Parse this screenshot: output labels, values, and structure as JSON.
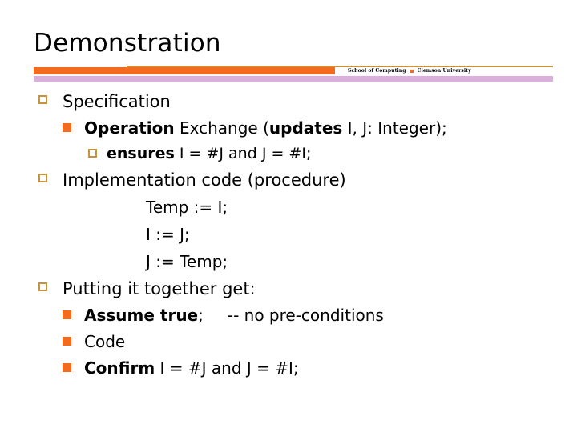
{
  "slide": {
    "title": "Demonstration",
    "header": {
      "credit_left": "School of Computing",
      "credit_sep_icon": "orange-square-icon",
      "credit_right": "Clemson University"
    },
    "colors": {
      "orange": "#F26B1F",
      "lavender": "#DBAEDB",
      "gold_rule": "#C9923E",
      "text": "#000000"
    },
    "bullets": {
      "level1_icon": "hollow-square-bullet-icon",
      "level2_icon": "filled-square-bullet-icon",
      "level3_icon": "hollow-square-bullet-icon"
    },
    "content": [
      {
        "level": 1,
        "name": "specification",
        "parts": [
          {
            "text": "Specification",
            "bold": false
          }
        ]
      },
      {
        "level": 2,
        "name": "operation-exchange",
        "parts": [
          {
            "text": "Operation",
            "bold": true
          },
          {
            "text": " Exchange (",
            "bold": false
          },
          {
            "text": "updates",
            "bold": true
          },
          {
            "text": " I, J: Integer);",
            "bold": false
          }
        ]
      },
      {
        "level": 3,
        "name": "ensures-clause",
        "parts": [
          {
            "text": "ensures",
            "bold": true
          },
          {
            "text": " I = #J and J = #I;",
            "bold": false
          }
        ]
      },
      {
        "level": 1,
        "name": "implementation-code",
        "parts": [
          {
            "text": "Implementation code (procedure)",
            "bold": false
          }
        ]
      },
      {
        "level": 0,
        "name": "code-line-1",
        "parts": [
          {
            "text": "Temp := I;",
            "bold": false
          }
        ]
      },
      {
        "level": 0,
        "name": "code-line-2",
        "parts": [
          {
            "text": "I := J;",
            "bold": false
          }
        ]
      },
      {
        "level": 0,
        "name": "code-line-3",
        "parts": [
          {
            "text": "J := Temp;",
            "bold": false
          }
        ]
      },
      {
        "level": 1,
        "name": "putting-it-together",
        "parts": [
          {
            "text": "Putting it together get:",
            "bold": false
          }
        ]
      },
      {
        "level": 2,
        "name": "assume-true",
        "parts": [
          {
            "text": "Assume true",
            "bold": true
          },
          {
            "text": ";",
            "bold": false
          },
          {
            "text": "-- no pre-conditions",
            "bold": false,
            "comment": true
          }
        ]
      },
      {
        "level": 2,
        "name": "code",
        "parts": [
          {
            "text": "Code",
            "bold": false
          }
        ]
      },
      {
        "level": 2,
        "name": "confirm",
        "parts": [
          {
            "text": "Confirm",
            "bold": true
          },
          {
            "text": " I = #J and J = #I;",
            "bold": false
          }
        ]
      }
    ]
  }
}
